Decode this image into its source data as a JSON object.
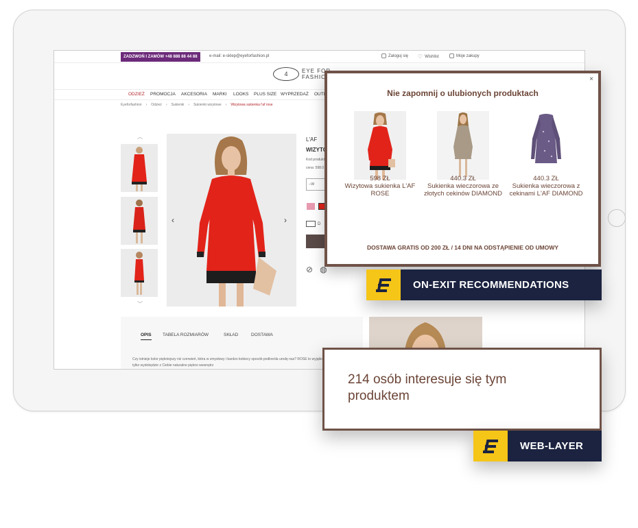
{
  "store": {
    "call_badge": "ZADZWOŃ I ZAMÓW +48 888 88 44 88",
    "email": "e-mail: e-sklep@eyeforfashion.pl",
    "login": "Zaloguj się",
    "wishlist": "Wishlist",
    "cart": "Moje zakupy",
    "logo_mark": "4",
    "logo_line1": "EYE FOR",
    "logo_line2": "FASHION",
    "nav": [
      "ODZIEŻ",
      "PROMOCJA",
      "AKCESORIA",
      "MARKI",
      "LOOKS",
      "PLUS SIZE",
      "WYPRZEDAŻ",
      "OUTLET"
    ],
    "breadcrumbs": [
      "Eyeforfashion",
      "Odzież",
      "Sukienki",
      "Sukienki wizytowe",
      "Wizytowa sukienka l'af rose"
    ],
    "product": {
      "brand": "L'AF",
      "name": "WIZYTO",
      "code": "Kod produktu",
      "price": "cena: 598.0",
      "size_placeholder": "--W",
      "ship": "D"
    },
    "tabs": [
      "OPIS",
      "TABELA ROZMIARÓW",
      "SKŁAD",
      "DOSTAWA"
    ],
    "description": "Czy istnieje kolor piękniejszy niż czerwień, która w zmysłowy i bardzo kobiecy sposób podkreśla urodę nas? ROSE to wyjątkowa sukienka, która nie tylko wydobędzie z Ciebie naturalne piękno wewnętrz"
  },
  "popup": {
    "close": "×",
    "title": "Nie zapomnij o ulubionych produktach",
    "products": [
      {
        "name": "Wizytowa sukienka L'AF ROSE",
        "price": "598 ZŁ"
      },
      {
        "name": "Sukienka wieczorowa ze złotych cekinów DIAMOND",
        "price": "440.3 ZŁ"
      },
      {
        "name": "Sukienka wieczorowa z cekinami L'AF DIAMOND",
        "price": "440.3 ZŁ"
      }
    ],
    "footer": "DOSTAWA GRATIS OD 200 ZŁ / 14 DNI NA ODSTĄPIENIE OD UMOWY"
  },
  "labels": {
    "on_exit": "ON-EXIT RECOMMENDATIONS",
    "web_layer": "WEB-LAYER"
  },
  "weblayer": {
    "text": "214 osób interesuje się tym produktem"
  },
  "colors": {
    "brand_dark": "#1b2340",
    "brand_yellow": "#f5c518",
    "popup_border": "#6f5248",
    "popup_text": "#6b4436",
    "store_accent": "#b3262d",
    "call_badge": "#6c2a7a"
  }
}
